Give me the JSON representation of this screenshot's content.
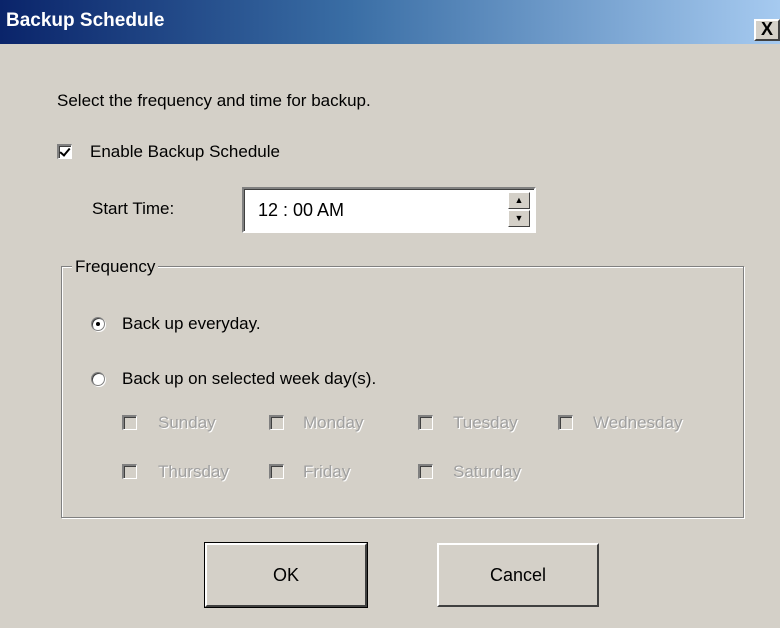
{
  "window": {
    "title": "Backup Schedule",
    "close_label": "X"
  },
  "instructions": "Select the frequency and time for backup.",
  "enable_schedule": {
    "label": "Enable Backup Schedule",
    "checked": true
  },
  "start_time": {
    "label": "Start Time:",
    "value": "12 : 00  AM"
  },
  "frequency": {
    "legend": "Frequency",
    "options": [
      {
        "label": "Back up everyday.",
        "selected": true
      },
      {
        "label": "Back up on selected week day(s).",
        "selected": false
      }
    ],
    "weekdays": [
      {
        "label": "Sunday",
        "checked": false,
        "enabled": false
      },
      {
        "label": "Monday",
        "checked": false,
        "enabled": false
      },
      {
        "label": "Tuesday",
        "checked": false,
        "enabled": false
      },
      {
        "label": "Wednesday",
        "checked": false,
        "enabled": false
      },
      {
        "label": "Thursday",
        "checked": false,
        "enabled": false
      },
      {
        "label": "Friday",
        "checked": false,
        "enabled": false
      },
      {
        "label": "Saturday",
        "checked": false,
        "enabled": false
      }
    ]
  },
  "buttons": {
    "ok": "OK",
    "cancel": "Cancel"
  },
  "colors": {
    "titlebar_start": "#0a246a",
    "titlebar_end": "#a6caf0",
    "dialog_bg": "#d4d0c8",
    "disabled_text": "#a0a0a0"
  }
}
